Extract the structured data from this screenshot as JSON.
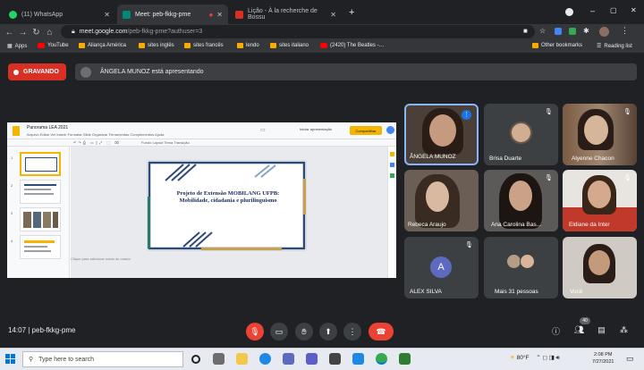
{
  "browser": {
    "tabs": [
      {
        "label": "(11) WhatsApp",
        "color": "#25d366",
        "active": false
      },
      {
        "label": "Meet: peb-fkkg-pme",
        "color": "#00897b",
        "active": true
      },
      {
        "label": "Lição - À la recherche de Bossu",
        "color": "#d93025",
        "active": false
      }
    ],
    "new_tab": "+",
    "url_host": "meet.google.com",
    "url_path": "/peb-fkkg-pme?authuser=3",
    "bookmarks": [
      "Apps",
      "YouTube",
      "Aliança América",
      "sites inglês",
      "sites francês",
      "lendo",
      "sites italiano",
      "(2420) The Beatles -…"
    ],
    "other_bookmarks": "Other bookmarks",
    "reading_list": "Reading list"
  },
  "meet": {
    "recording": "GRAVANDO",
    "presenting": "ÂNGELA MUNOZ está apresentando",
    "meeting_code": "14:07  |  peb-fkkg-pme",
    "participants_count": "40",
    "participants": [
      {
        "name": "ÂNGELA MUNOZ"
      },
      {
        "name": "Brisa Duarte"
      },
      {
        "name": "Alyenne Chacon"
      },
      {
        "name": "Rebeca Araujo"
      },
      {
        "name": "Ana Carolina Bas..."
      },
      {
        "name": "Eldiane da Inter"
      },
      {
        "name": "ALEX SILVA",
        "initial": "A"
      },
      {
        "name": "Mais 31 pessoas"
      },
      {
        "name": "Você"
      }
    ]
  },
  "slides": {
    "doc_title": "Panorama LEA 2021",
    "menu": "Arquivo  Editar  Ver  Inserir  Formatar  Slide  Organizar  Ferramentas  Complementos  Ajuda",
    "toolbar": "Fundo   Layout   Tema   Transição",
    "present": "Iniciar apresentação",
    "share": "Compartilhar",
    "thumb_numbers": [
      "1",
      "2",
      "3",
      "4"
    ],
    "slide_text": "Projeto de Extensão MOBILANG UFPB: Mobilidade, cidadania e plurilinguismo",
    "notes": "Clique para adicionar notas do orador"
  },
  "taskbar": {
    "search_placeholder": "Type here to search",
    "weather": "80°F",
    "time": "2:08 PM",
    "date": "7/27/2021"
  }
}
